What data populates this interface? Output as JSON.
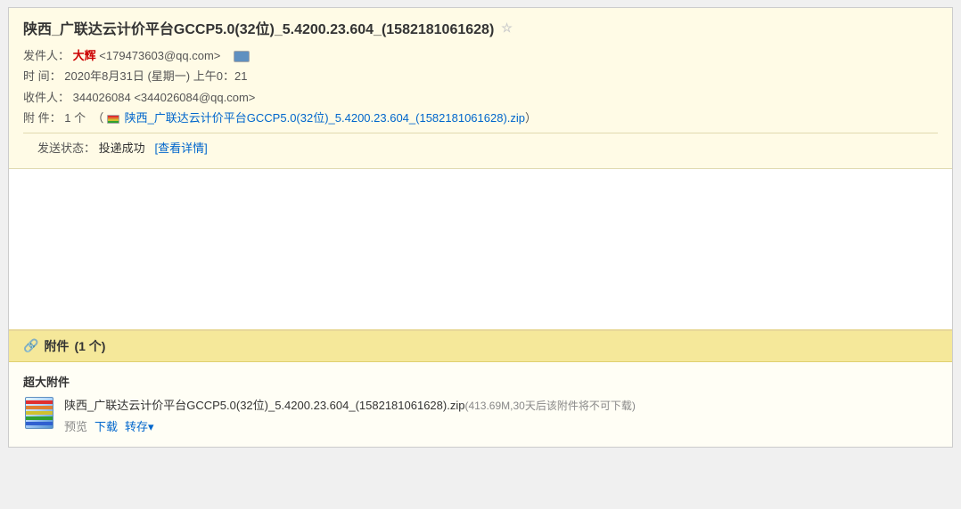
{
  "email": {
    "title": "陕西_广联达云计价平台GCCP5.0(32位)_5.4200.23.604_(1582181061628)",
    "star_symbol": "☆",
    "sender_label": "发件人：",
    "sender_name": "大辉",
    "sender_email": "<179473603@qq.com>",
    "time_label": "时  间：",
    "time_value": "2020年8月31日 (星期一) 上午0：21",
    "recipient_label": "收件人：",
    "recipient_value": "344026084 <344026084@qq.com>",
    "attachment_meta_label": "附  件：",
    "attachment_meta_count": "1 个",
    "attachment_inline_name": "陕西_广联达云计价平台GCCP5.0(32位)_5.4200.23.604_(1582181061628).zip",
    "status_label": "发送状态：",
    "status_value": "投递成功",
    "status_link": "[查看详情]"
  },
  "attachment_section": {
    "header_icon": "🔗",
    "header_label": "附件",
    "header_count": "(1 个)",
    "super_label": "超大附件",
    "filename": "陕西_广联达云计价平台GCCP5.0(32位)_5.4200.23.604_(1582181061628).zip",
    "file_meta": "(413.69M,30天后该附件将不可下载)",
    "action_preview": "预览",
    "action_download": "下载",
    "action_save": "转存",
    "action_save_arrow": "▾"
  }
}
